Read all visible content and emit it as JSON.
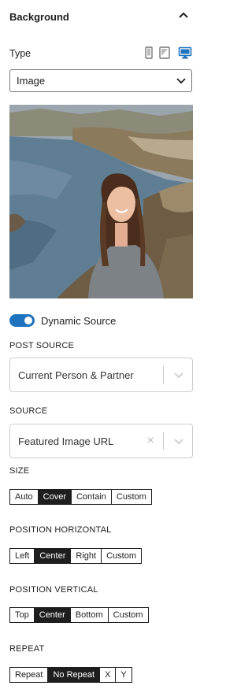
{
  "panel": {
    "title": "Background"
  },
  "type_field": {
    "label": "Type",
    "value": "Image",
    "devices": [
      "mobile-icon",
      "tablet-icon",
      "desktop-icon"
    ],
    "active_device": "desktop-icon"
  },
  "dynamic": {
    "label": "Dynamic Source",
    "enabled": true
  },
  "post_source": {
    "label": "POST SOURCE",
    "value": "Current Person & Partner"
  },
  "source": {
    "label": "SOURCE",
    "value": "Featured Image URL",
    "clear": "×"
  },
  "size": {
    "label": "SIZE",
    "options": [
      "Auto",
      "Cover",
      "Contain",
      "Custom"
    ],
    "active": "Cover"
  },
  "pos_h": {
    "label": "POSITION HORIZONTAL",
    "options": [
      "Left",
      "Center",
      "Right",
      "Custom"
    ],
    "active": "Center"
  },
  "pos_v": {
    "label": "POSITION VERTICAL",
    "options": [
      "Top",
      "Center",
      "Bottom",
      "Custom"
    ],
    "active": "Center"
  },
  "repeat": {
    "label": "REPEAT",
    "options": [
      "Repeat",
      "No Repeat",
      "X",
      "Y"
    ],
    "active": "No Repeat"
  },
  "colors": {
    "accent": "#1e73be",
    "dark": "#1e1e1e",
    "border": "#cccccc"
  }
}
